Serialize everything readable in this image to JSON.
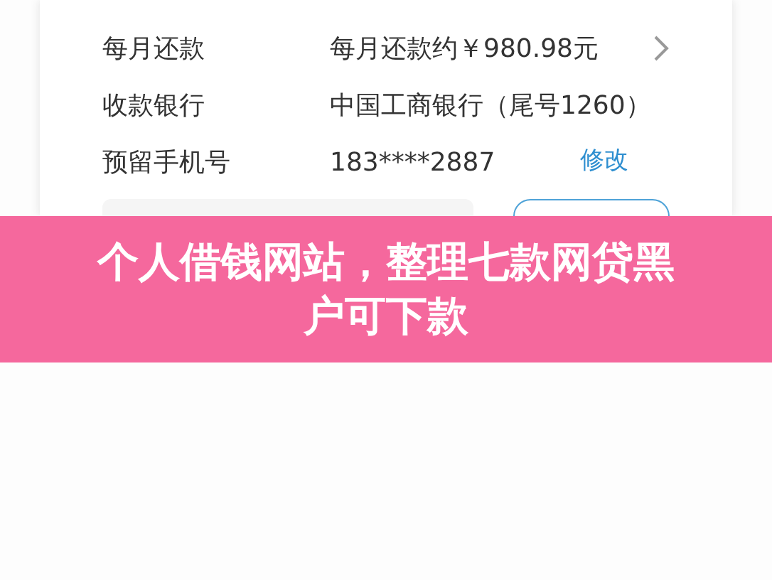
{
  "rows": [
    {
      "label": "每月还款",
      "value": "每月还款约￥980.98元",
      "kind": "chevron"
    },
    {
      "label": "收款银行",
      "value": "中国工商银行（尾号1260）",
      "kind": "plain"
    },
    {
      "label": "预留手机号",
      "value": "183****2887",
      "kind": "action",
      "action": "修改"
    }
  ],
  "banner": {
    "title": "个人借钱网站，整理七款网贷黑户可下款"
  }
}
